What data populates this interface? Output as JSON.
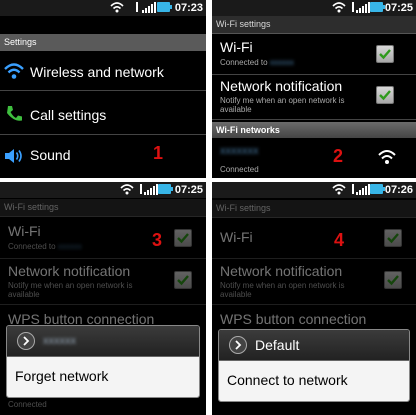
{
  "status": {
    "time1": "07:23",
    "time2": "07:25",
    "time3": "07:25",
    "time4": "07:26"
  },
  "panel1": {
    "header": "Settings",
    "items": [
      {
        "label": "Wireless and network",
        "icon": "wifi-icon"
      },
      {
        "label": "Call settings",
        "icon": "phone-icon"
      },
      {
        "label": "Sound",
        "icon": "speaker-icon"
      }
    ],
    "step": "1"
  },
  "panel2": {
    "header": "Wi-Fi settings",
    "wifi": {
      "title": "Wi-Fi",
      "sub": "Connected to"
    },
    "notif": {
      "title": "Network notification",
      "sub": "Notify me when an open network is available"
    },
    "section": "Wi-Fi networks",
    "network": {
      "sub": "Connected"
    },
    "step": "2"
  },
  "panel3": {
    "header": "Wi-Fi settings",
    "wifi": {
      "title": "Wi-Fi",
      "sub": "Connected to"
    },
    "notif": {
      "title": "Network notification",
      "sub": "Notify me when an open network is available"
    },
    "wps": "WPS button connection",
    "dialog_action": "Forget network",
    "bottom_sub": "Connected",
    "step": "3"
  },
  "panel4": {
    "header": "Wi-Fi settings",
    "wifi": {
      "title": "Wi-Fi"
    },
    "notif": {
      "title": "Network notification",
      "sub": "Notify me when an open network is available"
    },
    "wps": "WPS button connection",
    "dialog_title": "Default",
    "dialog_action": "Connect to network",
    "step": "4"
  },
  "colors": {
    "check_green": "#2f9a1c",
    "step_red": "#dd1111",
    "link_blue": "#4a7ea8"
  }
}
